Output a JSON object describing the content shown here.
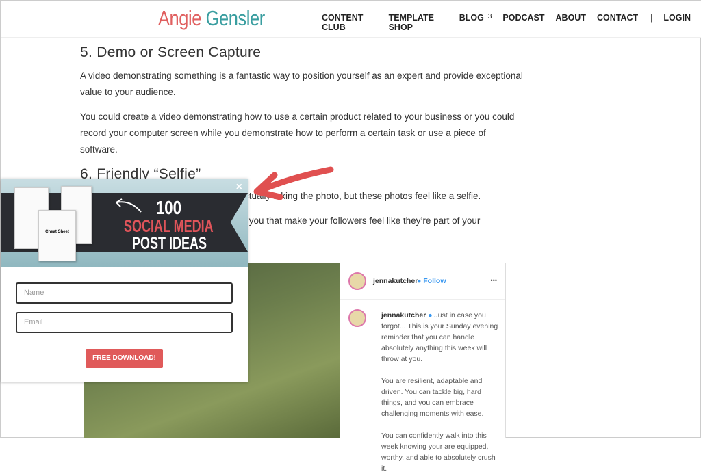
{
  "header": {
    "logo_first": "Angie",
    "logo_second": "Gensler",
    "nav": [
      "CONTENT CLUB",
      "TEMPLATE SHOP",
      "BLOG",
      "3",
      "PODCAST",
      "ABOUT",
      "CONTACT",
      "|",
      "LOGIN"
    ]
  },
  "article": {
    "h5": "5. Demo or Screen Capture",
    "p1": "A video demonstrating something is a fantastic way to position yourself as an expert and provide exceptional value to your audience.",
    "p2": "You could create a video demonstrating how to use a certain product related to your business or you could record your computer screen while you demonstrate how to perform a certain task or use a piece of software.",
    "h6": "6. Friendly “Selfie”",
    "p3": "not actually taking the photo, but these photos feel like a selfie.",
    "p4": "tos of you that make your followers feel like they’re part of your"
  },
  "popup": {
    "close": "×",
    "line1": "100",
    "line2": "SOCIAL MEDIA",
    "line3": "POST IDEAS",
    "sheet_title": "Cheat Sheet",
    "name_placeholder": "Name",
    "email_placeholder": "Email",
    "button": "FREE DOWNLOAD!"
  },
  "instagram": {
    "username": "jennakutcher",
    "follow": "Follow",
    "more": "•••",
    "caption": "Just in case you forgot... This is your Sunday evening reminder that you can handle absolutely anything this week will throw at you.",
    "caption2": "You are resilient, adaptable and driven. You can tackle big, hard things, and you can embrace challenging moments with ease.",
    "caption3": "You can confidently walk into this week knowing your are equipped, worthy, and able to absolutely crush it."
  },
  "colors": {
    "accent_red": "#e05a5a",
    "logo_teal": "#3a9ea0",
    "arrow": "#e05050"
  }
}
